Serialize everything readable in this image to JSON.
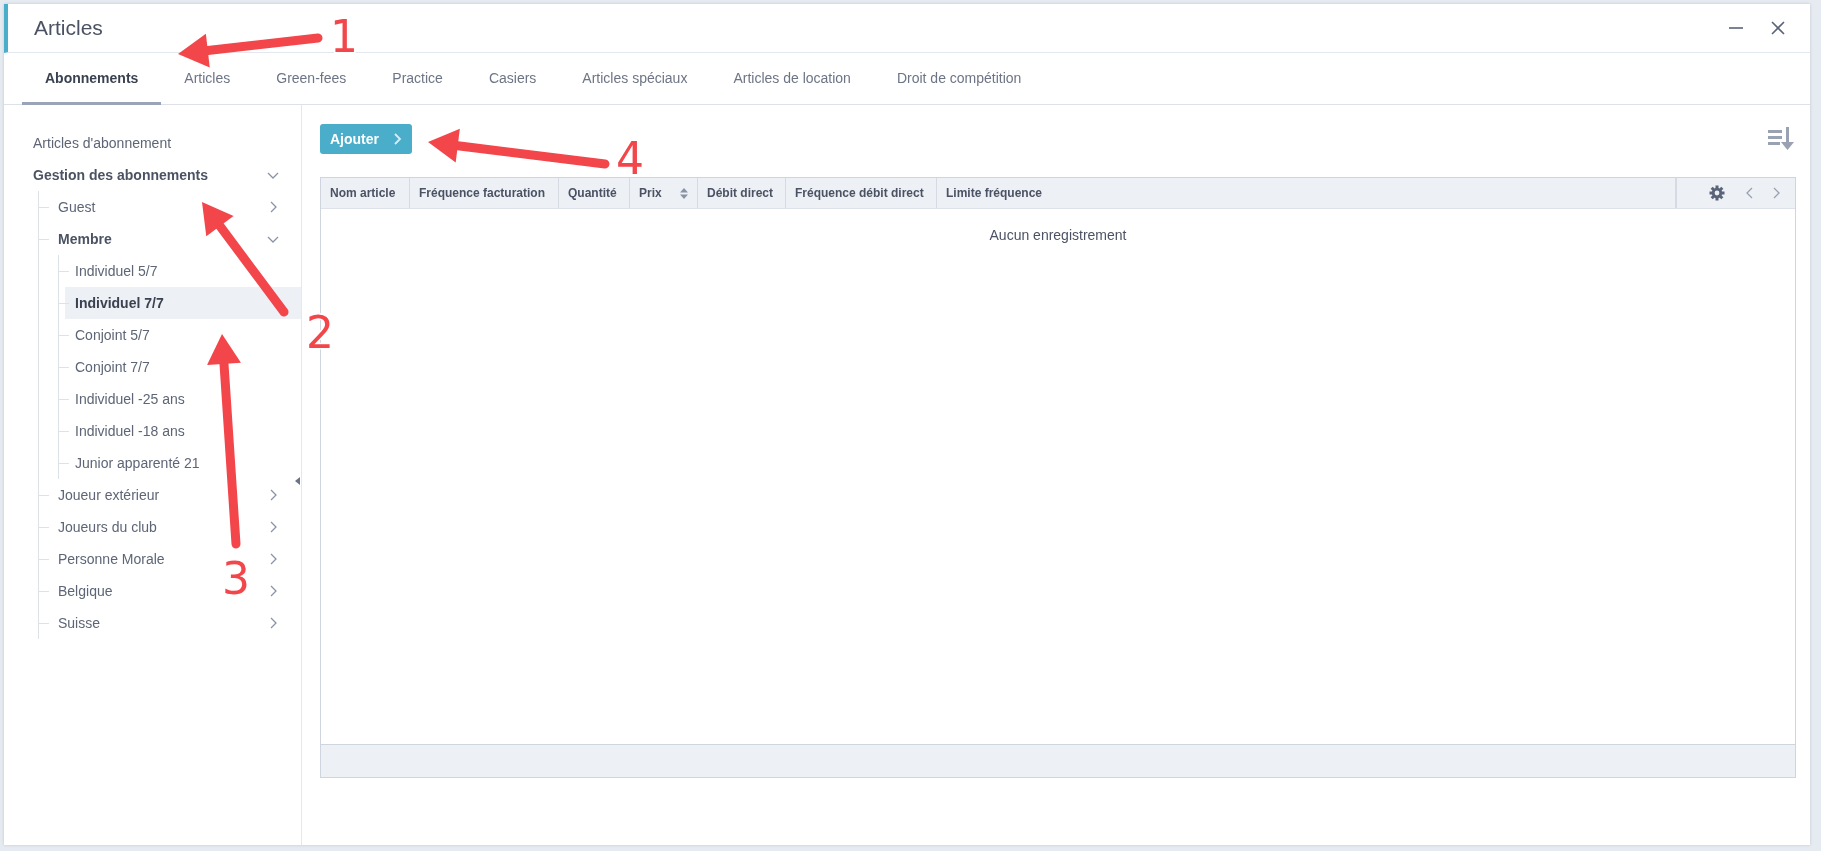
{
  "window": {
    "title": "Articles"
  },
  "tabs": [
    {
      "label": "Abonnements",
      "selected": true
    },
    {
      "label": "Articles",
      "selected": false
    },
    {
      "label": "Green-fees",
      "selected": false
    },
    {
      "label": "Practice",
      "selected": false
    },
    {
      "label": "Casiers",
      "selected": false
    },
    {
      "label": "Articles spéciaux",
      "selected": false
    },
    {
      "label": "Articles de location",
      "selected": false
    },
    {
      "label": "Droit de compétition",
      "selected": false
    }
  ],
  "sidebar": {
    "items": [
      {
        "label": "Articles d'abonnement",
        "selected": false
      },
      {
        "label": "Gestion des abonnements",
        "selected": false,
        "expanded": true,
        "children": [
          {
            "label": "Guest",
            "selected": false,
            "expanded": false
          },
          {
            "label": "Membre",
            "selected": false,
            "expanded": true,
            "children": [
              {
                "label": "Individuel 5/7",
                "selected": false
              },
              {
                "label": "Individuel 7/7",
                "selected": true
              },
              {
                "label": "Conjoint 5/7",
                "selected": false
              },
              {
                "label": "Conjoint 7/7",
                "selected": false
              },
              {
                "label": "Individuel -25 ans",
                "selected": false
              },
              {
                "label": "Individuel -18 ans",
                "selected": false
              },
              {
                "label": "Junior apparenté 21",
                "selected": false
              }
            ]
          },
          {
            "label": "Joueur extérieur",
            "selected": false,
            "expanded": false
          },
          {
            "label": "Joueurs du club",
            "selected": false,
            "expanded": false
          },
          {
            "label": "Personne Morale",
            "selected": false,
            "expanded": false
          },
          {
            "label": "Belgique",
            "selected": false,
            "expanded": false
          },
          {
            "label": "Suisse",
            "selected": false,
            "expanded": false
          }
        ]
      }
    ]
  },
  "toolbar": {
    "add_button": "Ajouter"
  },
  "table": {
    "columns": [
      {
        "label": "Nom article"
      },
      {
        "label": "Fréquence facturation"
      },
      {
        "label": "Quantité"
      },
      {
        "label": "Prix",
        "sortable": true
      },
      {
        "label": "Débit direct"
      },
      {
        "label": "Fréquence débit direct"
      },
      {
        "label": "Limite fréquence"
      }
    ],
    "empty_message": "Aucun enregistrement"
  },
  "annotations": [
    {
      "label": "1"
    },
    {
      "label": "2"
    },
    {
      "label": "3"
    },
    {
      "label": "4"
    }
  ]
}
